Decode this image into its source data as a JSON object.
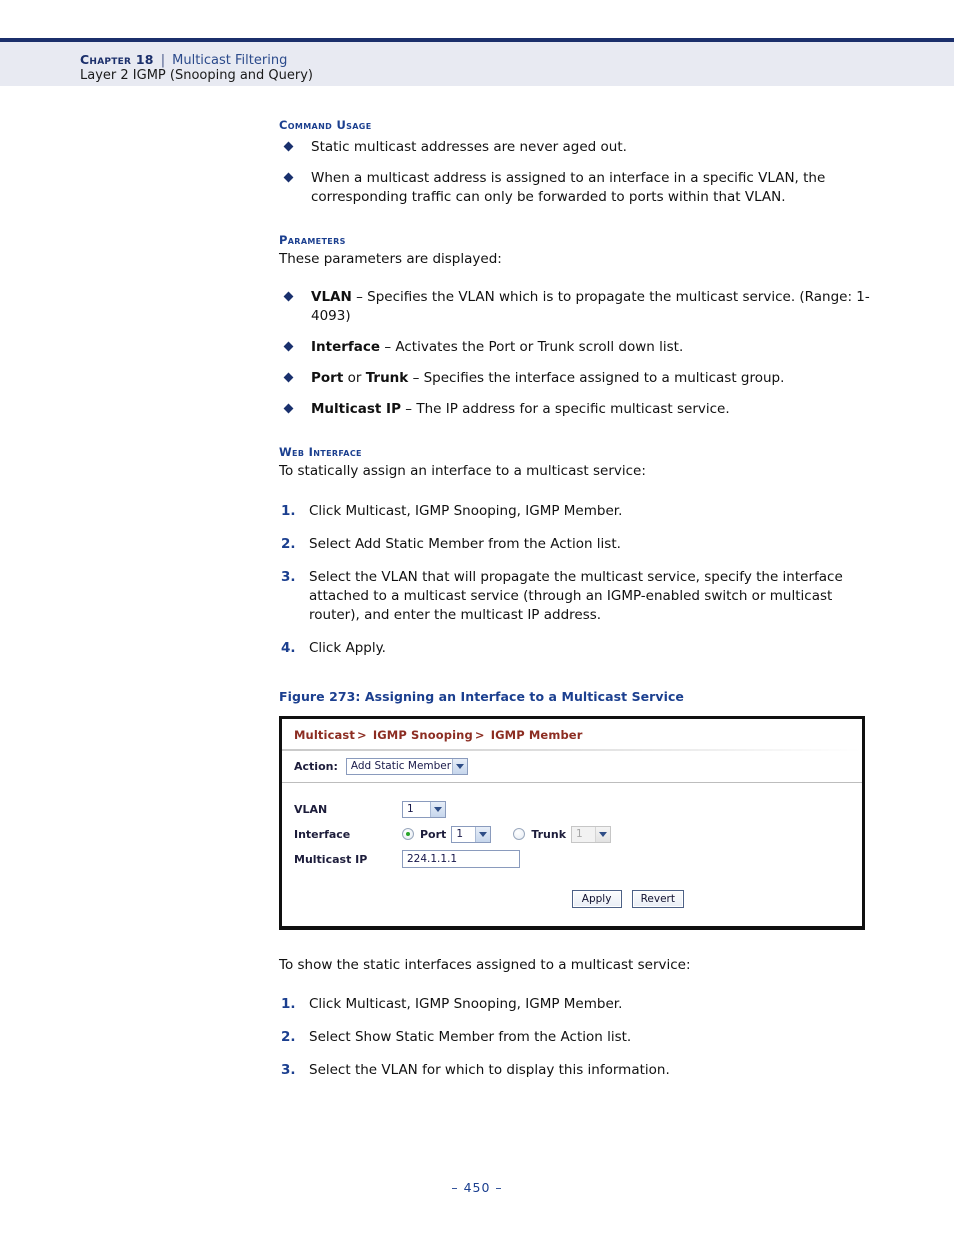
{
  "header": {
    "chapter_label": "Chapter 18",
    "separator": "|",
    "chapter_topic": "Multicast Filtering",
    "subtitle": "Layer 2 IGMP (Snooping and Query)"
  },
  "sections": {
    "command_usage": {
      "heading": "Command Usage",
      "bullets": [
        "Static multicast addresses are never aged out.",
        "When a multicast address is assigned to an interface in a specific VLAN, the corresponding traffic can only be forwarded to ports within that VLAN."
      ]
    },
    "parameters": {
      "heading": "Parameters",
      "intro": "These parameters are displayed:",
      "items": [
        {
          "term": "VLAN",
          "desc": " – Specifies the VLAN which is to propagate the multicast service. (Range: 1-4093)"
        },
        {
          "term": "Interface",
          "desc": " – Activates the Port or Trunk scroll down list."
        },
        {
          "term": "Port",
          "mid": " or ",
          "term2": "Trunk",
          "desc": " – Specifies the interface assigned to a multicast group."
        },
        {
          "term": "Multicast IP",
          "desc": " – The IP address for a specific multicast service."
        }
      ]
    },
    "web_interface": {
      "heading": "Web Interface",
      "intro": "To statically assign an interface to a multicast service:",
      "steps": [
        {
          "num": "1.",
          "text": "Click Multicast, IGMP Snooping, IGMP Member."
        },
        {
          "num": "2.",
          "text": "Select Add Static Member from the Action list."
        },
        {
          "num": "3.",
          "text": "Select the VLAN that will propagate the multicast service, specify the interface attached to a multicast service (through an IGMP-enabled switch or multicast router), and enter the multicast IP address."
        },
        {
          "num": "4.",
          "text": "Click Apply."
        }
      ]
    },
    "show_static": {
      "intro": "To show the static interfaces assigned to a multicast service:",
      "steps": [
        {
          "num": "1.",
          "text": "Click Multicast, IGMP Snooping, IGMP Member."
        },
        {
          "num": "2.",
          "text": "Select Show Static Member from the Action list."
        },
        {
          "num": "3.",
          "text": "Select the VLAN for which to display this information."
        }
      ]
    }
  },
  "figure": {
    "caption": "Figure 273:  Assigning an Interface to a Multicast Service",
    "breadcrumb": {
      "part1": "Multicast",
      "sep1": ">",
      "part2": "IGMP Snooping",
      "sep2": ">",
      "part3": "IGMP Member"
    },
    "action": {
      "label": "Action:",
      "value": "Add Static Member"
    },
    "fields": {
      "vlan_label": "VLAN",
      "vlan_value": "1",
      "interface_label": "Interface",
      "port_label": "Port",
      "port_value": "1",
      "trunk_label": "Trunk",
      "trunk_value": "1",
      "multicast_ip_label": "Multicast IP",
      "multicast_ip_value": "224.1.1.1"
    },
    "buttons": {
      "apply": "Apply",
      "revert": "Revert"
    }
  },
  "footer": {
    "page_number": "–  450  –"
  },
  "colors": {
    "header_band": "#e8eaf2",
    "navy": "#1b2f6b",
    "heading_blue": "#1b3f8f",
    "breadcrumb_red": "#8c2d22",
    "radio_selected": "#2aa52a"
  }
}
